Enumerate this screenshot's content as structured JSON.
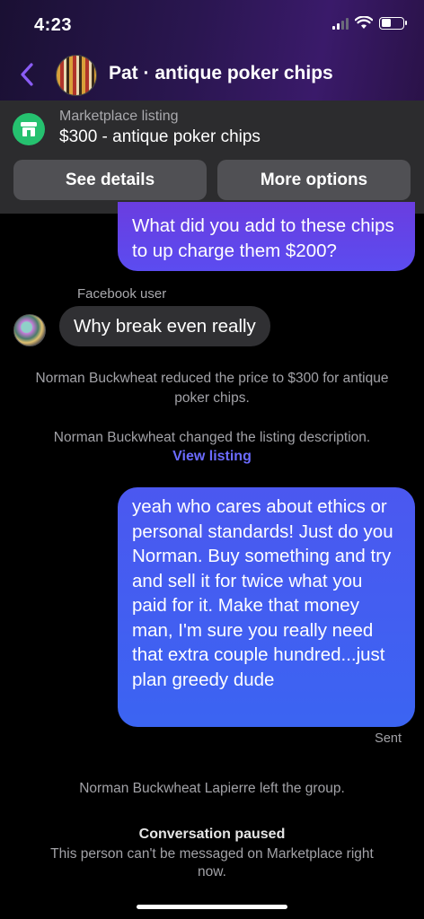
{
  "status_bar": {
    "time": "4:23",
    "signal_icon": "signal-icon",
    "wifi_icon": "wifi-icon",
    "battery_icon": "battery-icon",
    "battery_level": 0.45
  },
  "header": {
    "back_icon": "chevron-left-icon",
    "title": "Pat · antique poker chips",
    "accent": "#8a5cf5"
  },
  "listing": {
    "icon": "storefront-icon",
    "label": "Marketplace listing",
    "title": "$300 - antique poker chips",
    "details_button": "See details",
    "options_button": "More options"
  },
  "messages": {
    "outgoing_top": "What did you add to these chips to up charge them $200?",
    "sender_name": "Facebook user",
    "incoming": "Why break even really",
    "system_price": "Norman Buckwheat reduced the price to $300 for antique poker chips.",
    "system_description": "Norman Buckwheat changed the listing description.",
    "view_listing": "View listing",
    "outgoing_long": "yeah who cares about ethics or personal standards! Just do you Norman. Buy something and try and sell it for twice what you paid for it. Make that money man, I'm sure you really need that extra couple hundred...just plan greedy dude",
    "sent_status": "Sent",
    "system_left": "Norman Buckwheat Lapierre left the group."
  },
  "footer": {
    "paused_title": "Conversation paused",
    "paused_desc": "This person can't be messaged on Marketplace right now."
  },
  "colors": {
    "outgoing_bubble": "#4b58f0",
    "incoming_bubble": "#303033",
    "link": "#6b6bff",
    "store_green": "#25c16f"
  }
}
